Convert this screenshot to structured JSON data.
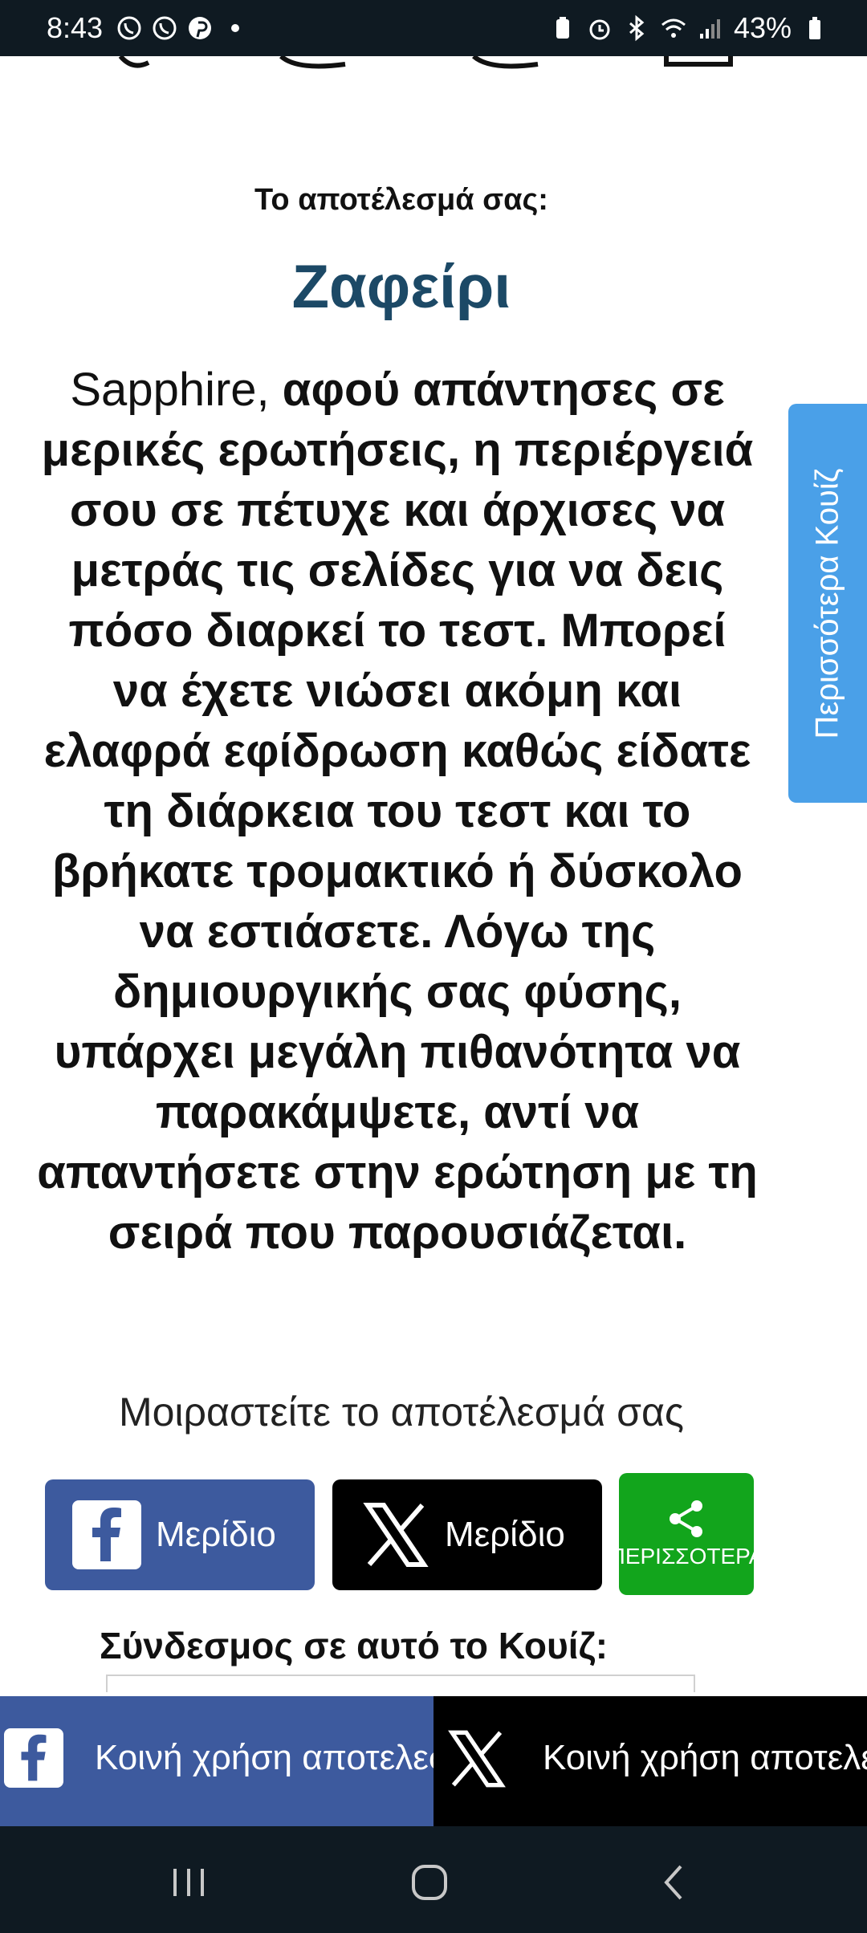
{
  "status_bar": {
    "time": "8:43",
    "battery": "43%",
    "icons_left": [
      "viber-icon",
      "viber-icon",
      "pinterest-icon",
      "dot-icon"
    ],
    "icons_right": [
      "battery-saver-icon",
      "alarm-icon",
      "bluetooth-icon",
      "wifi-icon",
      "signal-icon",
      "battery-icon"
    ]
  },
  "result": {
    "label": "Το αποτέλεσμά σας:",
    "title": "Ζαφείρι",
    "name": "Sapphire,",
    "description": "αφού απάντησες σε μερικές ερωτήσεις, η περιέργειά σου σε πέτυχε και άρχισες να μετράς τις σελίδες για να δεις πόσο διαρκεί το τεστ. Μπορεί να έχετε νιώσει ακόμη και ελαφρά εφίδρωση καθώς είδατε τη διάρκεια του τεστ και το βρήκατε τρομακτικό ή δύσκολο να εστιάσετε. Λόγω της δημιουργικής σας φύσης, υπάρχει μεγάλη πιθανότητα να παρακάμψετε, αντί να απαντήσετε στην ερώτηση με τη σειρά που παρουσιάζεται."
  },
  "share": {
    "heading": "Μοιραστείτε το αποτέλεσμά σας",
    "facebook_label": "Μερίδιο",
    "x_label": "Μερίδιο",
    "more_label": "ΠΕΡΙΣΣΟΤΕΡΑ"
  },
  "link": {
    "heading": "Σύνδεσμος σε αυτό το Κουίζ:"
  },
  "side_tab": {
    "label": "Περισσότερα Κουίζ"
  },
  "sticky_bar": {
    "facebook_text": "Κοινή χρήση αποτελεσμάτων",
    "x_text": "Κοινή χρήση αποτελεσμάτων"
  },
  "colors": {
    "title": "#1c4966",
    "facebook": "#3d5a9e",
    "x": "#000000",
    "more": "#12a51c",
    "side_tab": "#4aa0e8",
    "system_bar": "#0f1a22"
  }
}
